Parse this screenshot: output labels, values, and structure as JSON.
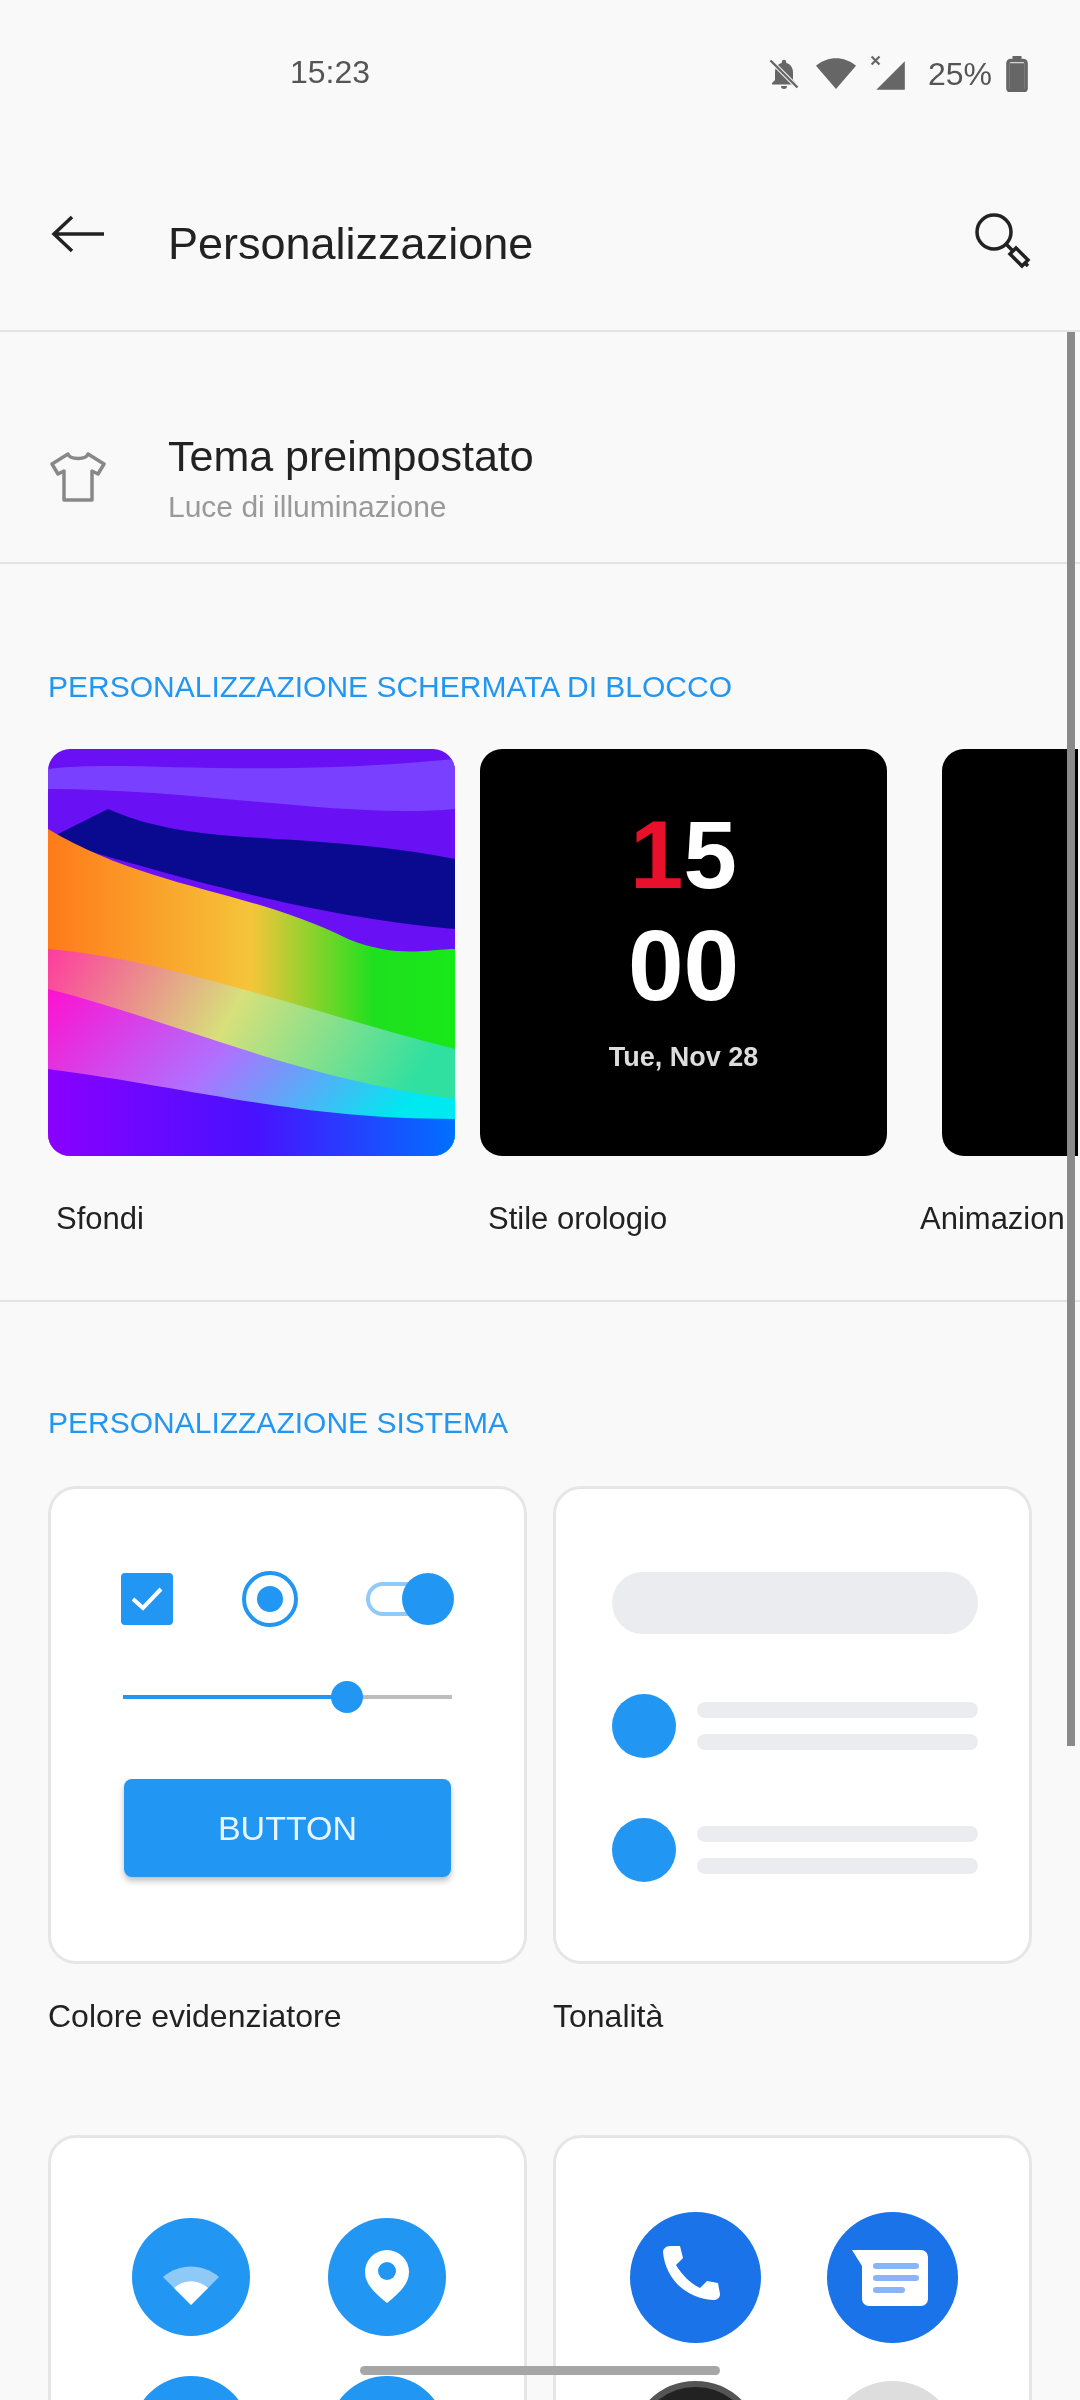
{
  "status_bar": {
    "time": "15:23",
    "battery": "25%"
  },
  "header": {
    "title": "Personalizzazione"
  },
  "theme_row": {
    "title": "Tema preimpostato",
    "subtitle": "Luce di illuminazione"
  },
  "lock_screen": {
    "heading": "PERSONALIZZAZIONE SCHERMATA DI BLOCCO",
    "items": [
      {
        "kind": "wallpaper",
        "label": "Sfondi"
      },
      {
        "kind": "clock",
        "label": "Stile orologio",
        "hour_tens": "1",
        "hour_ones": "5",
        "minutes": "00",
        "date": "Tue, Nov 28"
      },
      {
        "kind": "animation",
        "label": "Animazion"
      }
    ]
  },
  "system": {
    "heading": "PERSONALIZZAZIONE SISTEMA",
    "items": [
      {
        "kind": "accent",
        "label": "Colore evidenziatore",
        "preview": {
          "checkbox_checked": true,
          "radio_selected": true,
          "switch_on": true,
          "slider": {
            "level": 0.68
          },
          "button": "BUTTON"
        }
      },
      {
        "kind": "tone",
        "label": "Tonalità"
      },
      {
        "kind": "system_icons"
      },
      {
        "kind": "app_icons"
      }
    ]
  }
}
